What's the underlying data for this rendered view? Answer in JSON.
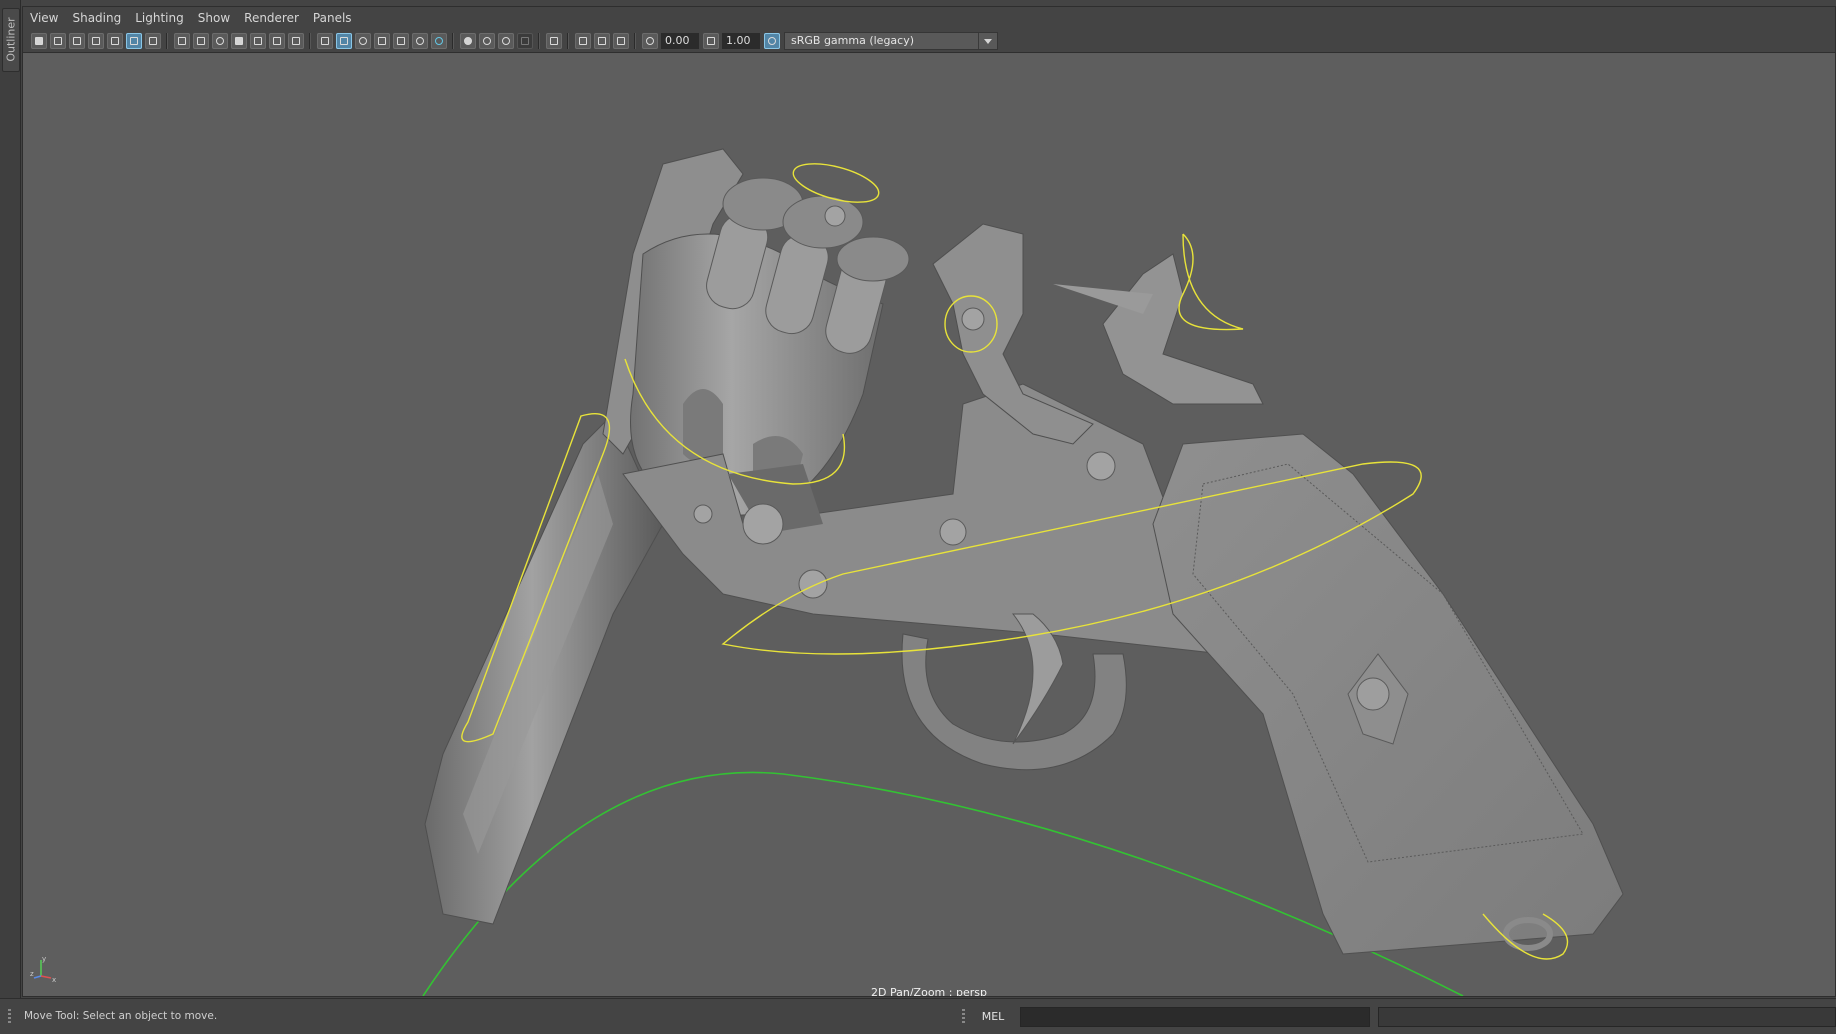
{
  "outliner": {
    "tab_label": "Outliner"
  },
  "menubar": {
    "items": [
      {
        "label": "View"
      },
      {
        "label": "Shading"
      },
      {
        "label": "Lighting"
      },
      {
        "label": "Show"
      },
      {
        "label": "Renderer"
      },
      {
        "label": "Panels"
      }
    ]
  },
  "toolbar": {
    "exposure_value": "0.00",
    "gamma_value": "1.00",
    "color_management": "sRGB gamma (legacy)"
  },
  "viewport": {
    "camera_label": "2D Pan/Zoom : persp",
    "axis_labels": {
      "x": "x",
      "y": "y",
      "z": "z"
    },
    "colors": {
      "background": "#5e5e5e",
      "model": "#8b8b8b",
      "nurbs_curve": "#e8e33a",
      "grid_curve": "#33c233"
    }
  },
  "statusbar": {
    "help_text": "Move Tool: Select an object to move.",
    "script_lang": "MEL"
  }
}
